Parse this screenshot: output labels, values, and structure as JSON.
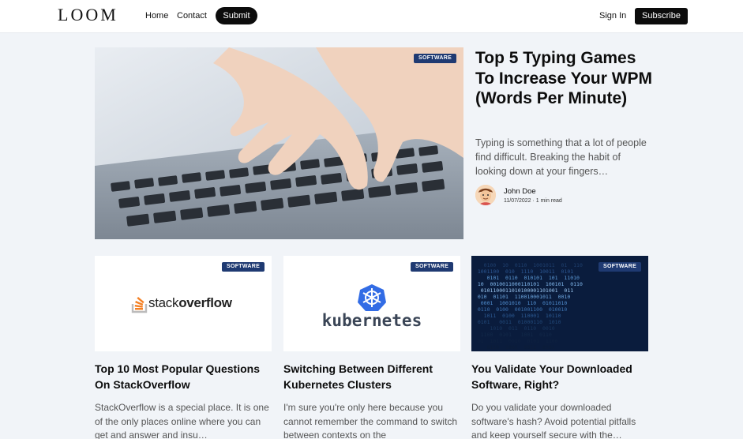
{
  "header": {
    "logo": "LOOM",
    "nav": {
      "home": "Home",
      "contact": "Contact",
      "submit": "Submit"
    },
    "signin": "Sign In",
    "subscribe": "Subscribe"
  },
  "featured": {
    "badge": "SOFTWARE",
    "title": "Top 5 Typing Games To Increase Your WPM (Words Per Minute)",
    "excerpt": "Typing is something that a lot of people find difficult. Breaking the habit of looking down at your fingers…",
    "author": "John Doe",
    "meta": "11/07/2022 · 1 min read"
  },
  "cards": [
    {
      "badge": "SOFTWARE",
      "image_text_a": "stack",
      "image_text_b": "overflow",
      "title": "Top 10 Most Popular Questions On StackOverflow",
      "excerpt": "StackOverflow is a special place. It is one of the only places online where you can get and answer and insu…"
    },
    {
      "badge": "SOFTWARE",
      "image_text": "kubernetes",
      "title": "Switching Between Different Kubernetes Clusters",
      "excerpt": "I'm sure you're only here because you cannot remember the command to switch between contexts on the"
    },
    {
      "badge": "SOFTWARE",
      "title": "You Validate Your Downloaded Software, Right?",
      "excerpt": "Do you validate your downloaded software's hash? Avoid potential pitfalls and keep yourself secure with the…"
    }
  ],
  "colors": {
    "badge": "#1f3a72",
    "button": "#0c0c0c",
    "background": "#f1f4f8",
    "kubernetes_blue": "#326ce5",
    "stackoverflow_orange": "#f48024"
  }
}
